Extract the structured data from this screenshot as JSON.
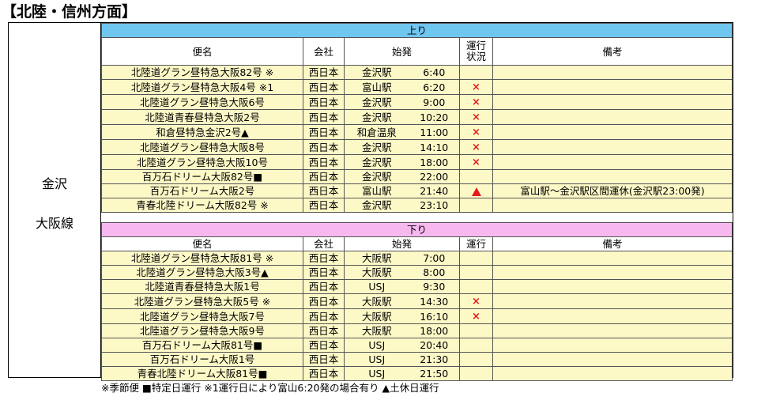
{
  "title": "【北陸・信州方面】",
  "route_name": [
    "金沢",
    "大阪線"
  ],
  "up": {
    "label": "上り",
    "headers": {
      "name": "便名",
      "company": "会社",
      "departure": "始発",
      "status": "運行\n状況",
      "notes": "備考"
    },
    "rows": [
      {
        "name": "北陸道グラン昼特急大阪82号 ※",
        "company": "西日本",
        "station": "金沢駅",
        "time": "6:40",
        "status": "",
        "note": ""
      },
      {
        "name": "北陸道グラン昼特急大阪4号 ※1",
        "company": "西日本",
        "station": "富山駅",
        "time": "6:20",
        "status": "×",
        "note": ""
      },
      {
        "name": "北陸道グラン昼特急大阪6号",
        "company": "西日本",
        "station": "金沢駅",
        "time": "9:00",
        "status": "×",
        "note": ""
      },
      {
        "name": "北陸道青春昼特急大阪2号",
        "company": "西日本",
        "station": "金沢駅",
        "time": "10:20",
        "status": "×",
        "note": ""
      },
      {
        "name": "和倉昼特急金沢2号▲",
        "company": "西日本",
        "station": "和倉温泉",
        "time": "11:00",
        "status": "×",
        "note": ""
      },
      {
        "name": "北陸道グラン昼特急大阪8号",
        "company": "西日本",
        "station": "金沢駅",
        "time": "14:10",
        "status": "×",
        "note": ""
      },
      {
        "name": "北陸道グラン昼特急大阪10号",
        "company": "西日本",
        "station": "金沢駅",
        "time": "18:00",
        "status": "×",
        "note": ""
      },
      {
        "name": "百万石ドリーム大阪82号■",
        "company": "西日本",
        "station": "金沢駅",
        "time": "22:00",
        "status": "",
        "note": ""
      },
      {
        "name": "百万石ドリーム大阪2号",
        "company": "西日本",
        "station": "富山駅",
        "time": "21:40",
        "status": "▲",
        "note": "富山駅～金沢駅区間運休(金沢駅23:00発)"
      },
      {
        "name": "青春北陸ドリーム大阪82号 ※",
        "company": "西日本",
        "station": "金沢駅",
        "time": "23:10",
        "status": "",
        "note": ""
      }
    ]
  },
  "down": {
    "label": "下り",
    "headers": {
      "name": "便名",
      "company": "会社",
      "departure": "始発",
      "status": "運行",
      "notes": "備考"
    },
    "rows": [
      {
        "name": "北陸道グラン昼特急大阪81号 ※",
        "company": "西日本",
        "station": "大阪駅",
        "time": "7:00",
        "status": "",
        "note": ""
      },
      {
        "name": "北陸道グラン昼特急大阪3号▲",
        "company": "西日本",
        "station": "大阪駅",
        "time": "8:00",
        "status": "",
        "note": ""
      },
      {
        "name": "北陸道青春昼特急大阪1号",
        "company": "西日本",
        "station": "USJ",
        "time": "9:30",
        "status": "",
        "note": ""
      },
      {
        "name": "北陸道グラン昼特急大阪5号 ※",
        "company": "西日本",
        "station": "大阪駅",
        "time": "14:30",
        "status": "×",
        "note": ""
      },
      {
        "name": "北陸道グラン昼特急大阪7号",
        "company": "西日本",
        "station": "大阪駅",
        "time": "16:10",
        "status": "×",
        "note": ""
      },
      {
        "name": "北陸道グラン昼特急大阪9号",
        "company": "西日本",
        "station": "大阪駅",
        "time": "18:00",
        "status": "",
        "note": ""
      },
      {
        "name": "百万石ドリーム大阪81号■",
        "company": "西日本",
        "station": "USJ",
        "time": "20:40",
        "status": "",
        "note": ""
      },
      {
        "name": "百万石ドリーム大阪1号",
        "company": "西日本",
        "station": "USJ",
        "time": "21:30",
        "status": "",
        "note": ""
      },
      {
        "name": "青春北陸ドリーム大阪81号■",
        "company": "西日本",
        "station": "USJ",
        "time": "21:50",
        "status": "",
        "note": ""
      }
    ]
  },
  "footnote": "※季節便 ■特定日運行 ※1運行日により富山6:20発の場合有り ▲土休日運行",
  "colors": {
    "up_header": "#6fc6ef",
    "down_header": "#f6b8ee",
    "row_bg": "#fdf9c7",
    "status_mark": "#e21c1c"
  }
}
